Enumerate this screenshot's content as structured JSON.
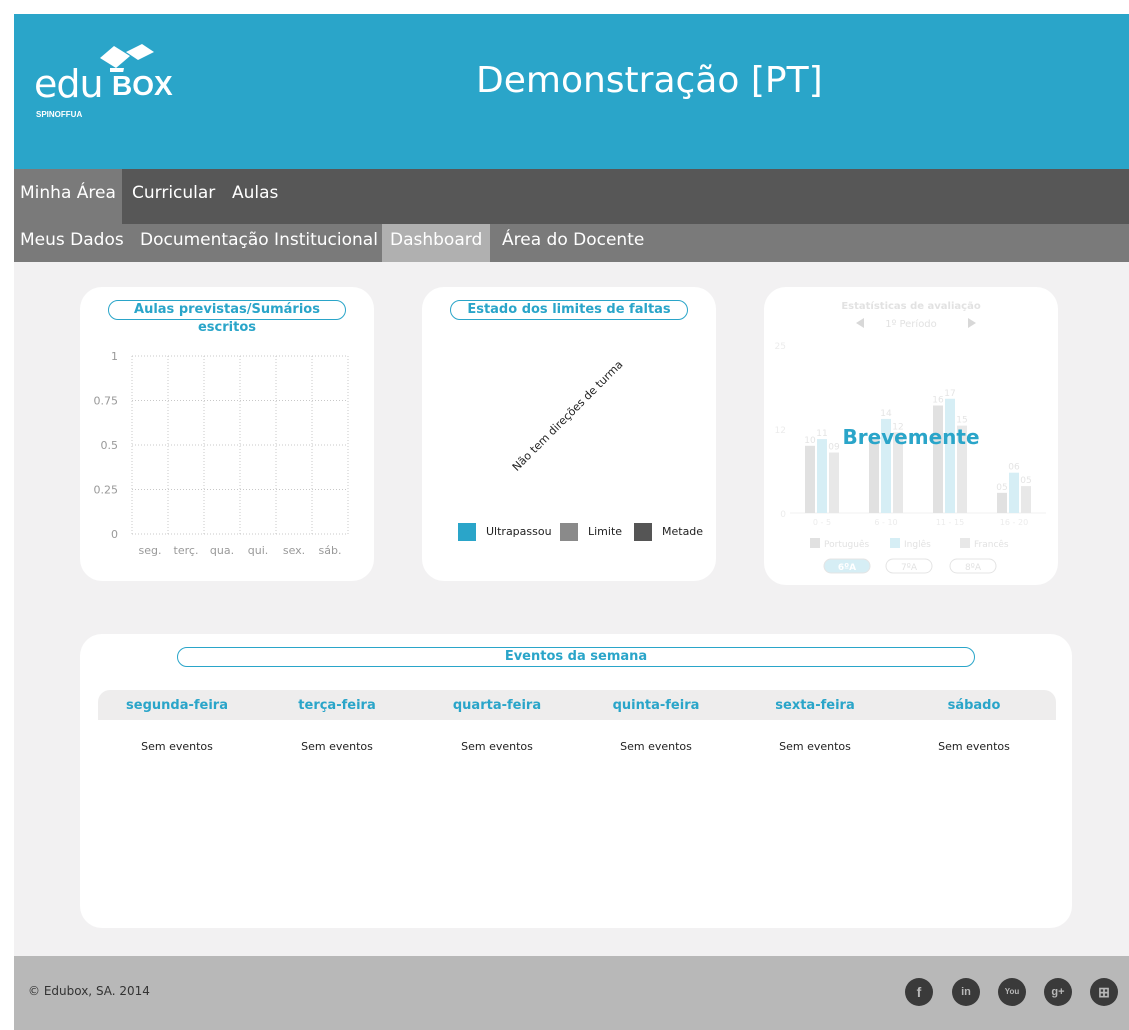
{
  "header": {
    "logo_edu": "edu",
    "logo_box": "BOX",
    "logo_sub": "SPINOFFUA",
    "title": "Demonstração [PT]"
  },
  "nav_primary": [
    "Minha Área",
    "Curricular",
    "Aulas"
  ],
  "nav_secondary": [
    "Meus Dados",
    "Documentação Institucional",
    "Dashboard",
    "Área do Docente"
  ],
  "cards": {
    "aulas": {
      "title": "Aulas previstas/Sumários escritos",
      "chart_data": {
        "type": "line",
        "title": "Aulas previstas/Sumários escritos",
        "categories": [
          "seg.",
          "terç.",
          "qua.",
          "qui.",
          "sex.",
          "sáb."
        ],
        "y_ticks": [
          "1",
          "0.75",
          "0.5",
          "0.25",
          "0"
        ],
        "ylim": [
          0,
          1
        ],
        "series": [],
        "grid": true
      }
    },
    "faltas": {
      "title": "Estado dos limites de faltas",
      "message": "Não tem direções de turma",
      "legend": [
        {
          "label": "Ultrapassou",
          "color": "#2aa5c9"
        },
        {
          "label": "Limite",
          "color": "#8a8a8a"
        },
        {
          "label": "Metade",
          "color": "#555555"
        }
      ]
    },
    "estatisticas": {
      "title": "Estatísticas de avaliação",
      "period": "1º Período",
      "overlay": "Brevemente",
      "y_ticks": [
        "25",
        "12",
        "0"
      ],
      "groups": [
        "0 - 5",
        "6 - 10",
        "11 - 15",
        "16 - 20"
      ],
      "legend": [
        "Português",
        "Inglês",
        "Francês"
      ],
      "classes": [
        "6ºA",
        "7ºA",
        "8ºA"
      ],
      "chart_data": {
        "type": "bar",
        "title": "Estatísticas de avaliação",
        "categories": [
          "0 - 5",
          "6 - 10",
          "11 - 15",
          "16 - 20"
        ],
        "ylim": [
          0,
          25
        ],
        "series": [
          {
            "name": "Português",
            "values": [
              10,
              11,
              16,
              3
            ]
          },
          {
            "name": "Inglês",
            "values": [
              11,
              14,
              17,
              6
            ]
          },
          {
            "name": "Francês",
            "values": [
              9,
              12,
              13,
              4
            ]
          }
        ],
        "labels": [
          [
            "10",
            "11",
            "09"
          ],
          [
            "",
            "14",
            "12"
          ],
          [
            "16",
            "17",
            "15"
          ],
          [
            "05",
            "06",
            "05"
          ]
        ]
      }
    }
  },
  "events": {
    "title": "Eventos da semana",
    "days": [
      {
        "name": "segunda-feira",
        "text": "Sem eventos"
      },
      {
        "name": "terça-feira",
        "text": "Sem eventos"
      },
      {
        "name": "quarta-feira",
        "text": "Sem eventos"
      },
      {
        "name": "quinta-feira",
        "text": "Sem eventos"
      },
      {
        "name": "sexta-feira",
        "text": "Sem eventos"
      },
      {
        "name": "sábado",
        "text": "Sem eventos"
      }
    ]
  },
  "footer": {
    "copyright": "© Edubox, SA. 2014",
    "social": [
      "facebook-icon",
      "linkedin-icon",
      "youtube-icon",
      "google-plus-icon",
      "windows-icon"
    ]
  },
  "colors": {
    "accent": "#2aa5c9",
    "nav_dark": "#575757",
    "nav_mid": "#7a7a7a",
    "background": "#f2f1f2"
  }
}
